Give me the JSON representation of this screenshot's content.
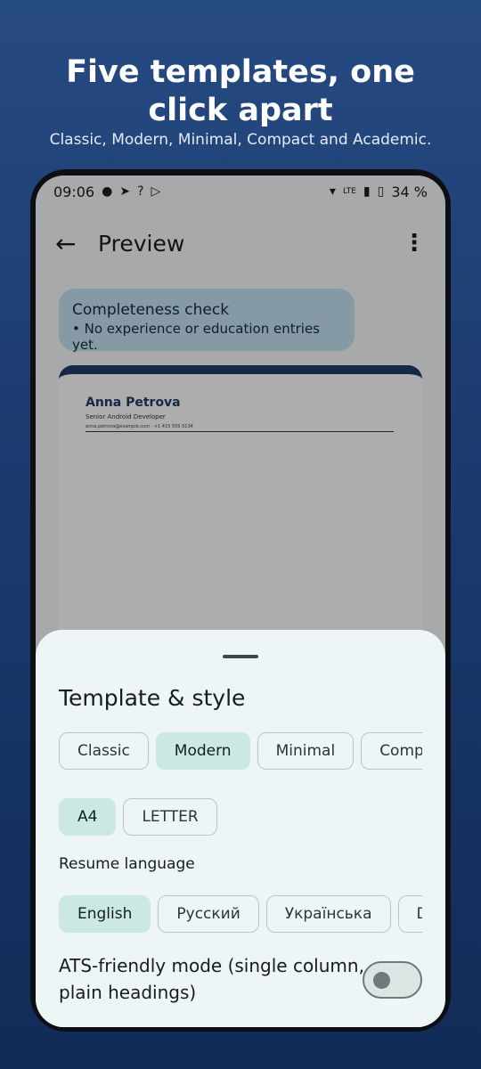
{
  "hero": {
    "title": "Five templates, one click apart",
    "subtitle": "Classic, Modern, Minimal, Compact and Academic."
  },
  "status_bar": {
    "time": "09:06",
    "battery": "34 %",
    "network": "LTE"
  },
  "app_bar": {
    "title": "Preview"
  },
  "completeness": {
    "title": "Completeness check",
    "item": "• No experience or education entries yet."
  },
  "resume": {
    "name": "Anna Petrova",
    "role": "Senior Android Developer",
    "contact": "anna.petrova@example.com  ·  +1 415 555 0134"
  },
  "sheet": {
    "title": "Template & style",
    "templates": [
      {
        "label": "Classic",
        "selected": false
      },
      {
        "label": "Modern",
        "selected": true
      },
      {
        "label": "Minimal",
        "selected": false
      },
      {
        "label": "Compact",
        "selected": false
      }
    ],
    "page_sizes": [
      {
        "label": "A4",
        "selected": true
      },
      {
        "label": "LETTER",
        "selected": false
      }
    ],
    "language_label": "Resume language",
    "languages": [
      {
        "label": "English",
        "selected": true
      },
      {
        "label": "Русский",
        "selected": false
      },
      {
        "label": "Українська",
        "selected": false
      },
      {
        "label": "Deutsch",
        "selected": false
      }
    ],
    "ats_label": "ATS-friendly mode (single column, plain headings)",
    "ats_enabled": false
  }
}
